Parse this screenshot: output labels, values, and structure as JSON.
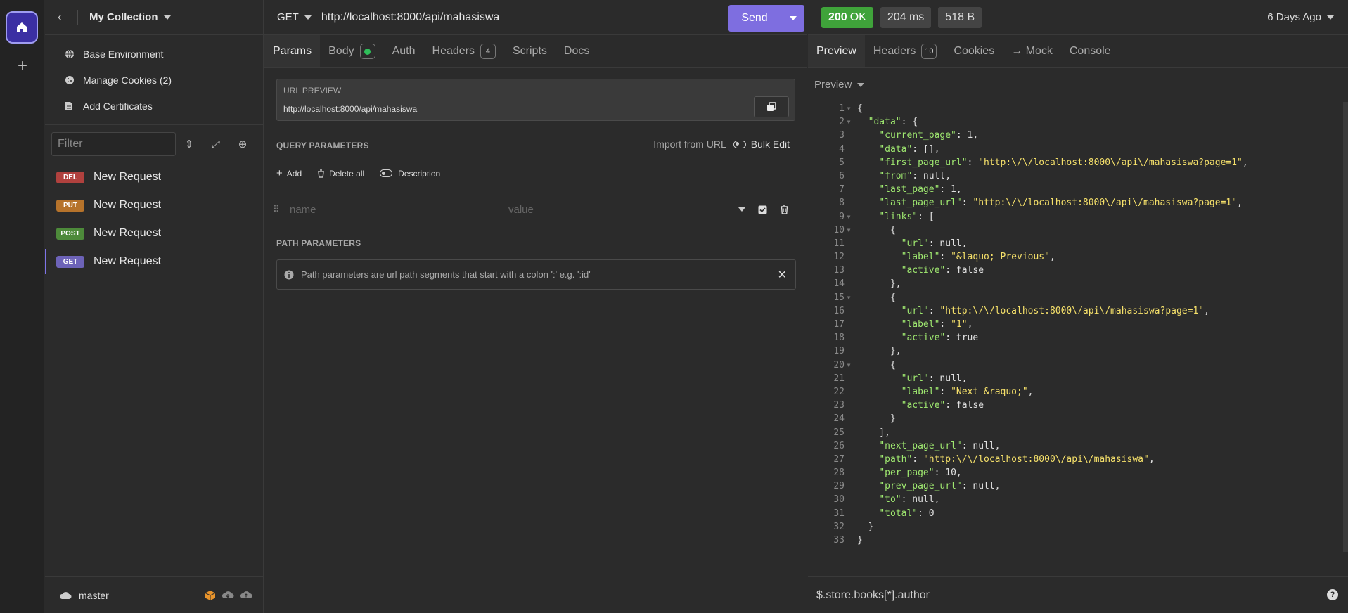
{
  "collection": {
    "title": "My Collection"
  },
  "sidebar": {
    "menu": [
      {
        "label": "Base Environment",
        "icon": "globe-icon"
      },
      {
        "label": "Manage Cookies (2)",
        "icon": "cookie-icon"
      },
      {
        "label": "Add Certificates",
        "icon": "certificate-icon"
      }
    ],
    "filter_placeholder": "Filter",
    "requests": [
      {
        "method": "DEL",
        "name": "New Request",
        "color": "#b0413e"
      },
      {
        "method": "PUT",
        "name": "New Request",
        "color": "#b6732b"
      },
      {
        "method": "POST",
        "name": "New Request",
        "color": "#4d8a3a"
      },
      {
        "method": "GET",
        "name": "New Request",
        "color": "#6d63b8"
      }
    ],
    "branch": "master"
  },
  "request": {
    "method": "GET",
    "url": "http://localhost:8000/api/mahasiswa",
    "send_label": "Send",
    "tabs": {
      "params": "Params",
      "body": "Body",
      "auth": "Auth",
      "headers": "Headers",
      "headers_count": "4",
      "scripts": "Scripts",
      "docs": "Docs"
    },
    "url_preview_caption": "URL PREVIEW",
    "url_preview": "http://localhost:8000/api/mahasiswa",
    "query_params_title": "QUERY PARAMETERS",
    "import_from_url": "Import from URL",
    "bulk_edit": "Bulk Edit",
    "add_label": "Add",
    "delete_all_label": "Delete all",
    "description_label": "Description",
    "name_placeholder": "name",
    "value_placeholder": "value",
    "path_params_title": "PATH PARAMETERS",
    "path_params_info": "Path parameters are url path segments that start with a colon ':' e.g. ':id'"
  },
  "response": {
    "status_code": "200",
    "status_text": "OK",
    "time": "204 ms",
    "size": "518 B",
    "ago": "6 Days Ago",
    "tabs": {
      "preview": "Preview",
      "headers": "Headers",
      "headers_count": "10",
      "cookies": "Cookies",
      "mock": "→ Mock",
      "console": "Console"
    },
    "preview_mode": "Preview",
    "query_placeholder": "$.store.books[*].author",
    "lines": [
      {
        "n": "1",
        "f": true,
        "t": [
          [
            "p",
            "{"
          ]
        ]
      },
      {
        "n": "2",
        "f": true,
        "t": [
          [
            "p",
            "  "
          ],
          [
            "k",
            "\"data\""
          ],
          [
            "p",
            ": {"
          ]
        ]
      },
      {
        "n": "3",
        "t": [
          [
            "p",
            "    "
          ],
          [
            "k",
            "\"current_page\""
          ],
          [
            "p",
            ": 1,"
          ]
        ]
      },
      {
        "n": "4",
        "t": [
          [
            "p",
            "    "
          ],
          [
            "k",
            "\"data\""
          ],
          [
            "p",
            ": [],"
          ]
        ]
      },
      {
        "n": "5",
        "t": [
          [
            "p",
            "    "
          ],
          [
            "k",
            "\"first_page_url\""
          ],
          [
            "p",
            ": "
          ],
          [
            "s",
            "\"http:\\/\\/localhost:8000\\/api\\/mahasiswa?page=1\""
          ],
          [
            "p",
            ","
          ]
        ]
      },
      {
        "n": "6",
        "t": [
          [
            "p",
            "    "
          ],
          [
            "k",
            "\"from\""
          ],
          [
            "p",
            ": null,"
          ]
        ]
      },
      {
        "n": "7",
        "t": [
          [
            "p",
            "    "
          ],
          [
            "k",
            "\"last_page\""
          ],
          [
            "p",
            ": 1,"
          ]
        ]
      },
      {
        "n": "8",
        "t": [
          [
            "p",
            "    "
          ],
          [
            "k",
            "\"last_page_url\""
          ],
          [
            "p",
            ": "
          ],
          [
            "s",
            "\"http:\\/\\/localhost:8000\\/api\\/mahasiswa?page=1\""
          ],
          [
            "p",
            ","
          ]
        ]
      },
      {
        "n": "9",
        "f": true,
        "t": [
          [
            "p",
            "    "
          ],
          [
            "k",
            "\"links\""
          ],
          [
            "p",
            ": ["
          ]
        ]
      },
      {
        "n": "10",
        "f": true,
        "t": [
          [
            "p",
            "      {"
          ]
        ]
      },
      {
        "n": "11",
        "t": [
          [
            "p",
            "        "
          ],
          [
            "k",
            "\"url\""
          ],
          [
            "p",
            ": null,"
          ]
        ]
      },
      {
        "n": "12",
        "t": [
          [
            "p",
            "        "
          ],
          [
            "k",
            "\"label\""
          ],
          [
            "p",
            ": "
          ],
          [
            "s",
            "\"&laquo; Previous\""
          ],
          [
            "p",
            ","
          ]
        ]
      },
      {
        "n": "13",
        "t": [
          [
            "p",
            "        "
          ],
          [
            "k",
            "\"active\""
          ],
          [
            "p",
            ": false"
          ]
        ]
      },
      {
        "n": "14",
        "t": [
          [
            "p",
            "      },"
          ]
        ]
      },
      {
        "n": "15",
        "f": true,
        "t": [
          [
            "p",
            "      {"
          ]
        ]
      },
      {
        "n": "16",
        "t": [
          [
            "p",
            "        "
          ],
          [
            "k",
            "\"url\""
          ],
          [
            "p",
            ": "
          ],
          [
            "s",
            "\"http:\\/\\/localhost:8000\\/api\\/mahasiswa?page=1\""
          ],
          [
            "p",
            ","
          ]
        ]
      },
      {
        "n": "17",
        "t": [
          [
            "p",
            "        "
          ],
          [
            "k",
            "\"label\""
          ],
          [
            "p",
            ": "
          ],
          [
            "s",
            "\"1\""
          ],
          [
            "p",
            ","
          ]
        ]
      },
      {
        "n": "18",
        "t": [
          [
            "p",
            "        "
          ],
          [
            "k",
            "\"active\""
          ],
          [
            "p",
            ": true"
          ]
        ]
      },
      {
        "n": "19",
        "t": [
          [
            "p",
            "      },"
          ]
        ]
      },
      {
        "n": "20",
        "f": true,
        "t": [
          [
            "p",
            "      {"
          ]
        ]
      },
      {
        "n": "21",
        "t": [
          [
            "p",
            "        "
          ],
          [
            "k",
            "\"url\""
          ],
          [
            "p",
            ": null,"
          ]
        ]
      },
      {
        "n": "22",
        "t": [
          [
            "p",
            "        "
          ],
          [
            "k",
            "\"label\""
          ],
          [
            "p",
            ": "
          ],
          [
            "s",
            "\"Next &raquo;\""
          ],
          [
            "p",
            ","
          ]
        ]
      },
      {
        "n": "23",
        "t": [
          [
            "p",
            "        "
          ],
          [
            "k",
            "\"active\""
          ],
          [
            "p",
            ": false"
          ]
        ]
      },
      {
        "n": "24",
        "t": [
          [
            "p",
            "      }"
          ]
        ]
      },
      {
        "n": "25",
        "t": [
          [
            "p",
            "    ],"
          ]
        ]
      },
      {
        "n": "26",
        "t": [
          [
            "p",
            "    "
          ],
          [
            "k",
            "\"next_page_url\""
          ],
          [
            "p",
            ": null,"
          ]
        ]
      },
      {
        "n": "27",
        "t": [
          [
            "p",
            "    "
          ],
          [
            "k",
            "\"path\""
          ],
          [
            "p",
            ": "
          ],
          [
            "s",
            "\"http:\\/\\/localhost:8000\\/api\\/mahasiswa\""
          ],
          [
            "p",
            ","
          ]
        ]
      },
      {
        "n": "28",
        "t": [
          [
            "p",
            "    "
          ],
          [
            "k",
            "\"per_page\""
          ],
          [
            "p",
            ": 10,"
          ]
        ]
      },
      {
        "n": "29",
        "t": [
          [
            "p",
            "    "
          ],
          [
            "k",
            "\"prev_page_url\""
          ],
          [
            "p",
            ": null,"
          ]
        ]
      },
      {
        "n": "30",
        "t": [
          [
            "p",
            "    "
          ],
          [
            "k",
            "\"to\""
          ],
          [
            "p",
            ": null,"
          ]
        ]
      },
      {
        "n": "31",
        "t": [
          [
            "p",
            "    "
          ],
          [
            "k",
            "\"total\""
          ],
          [
            "p",
            ": 0"
          ]
        ]
      },
      {
        "n": "32",
        "t": [
          [
            "p",
            "  }"
          ]
        ]
      },
      {
        "n": "33",
        "t": [
          [
            "p",
            "}"
          ]
        ]
      }
    ]
  }
}
